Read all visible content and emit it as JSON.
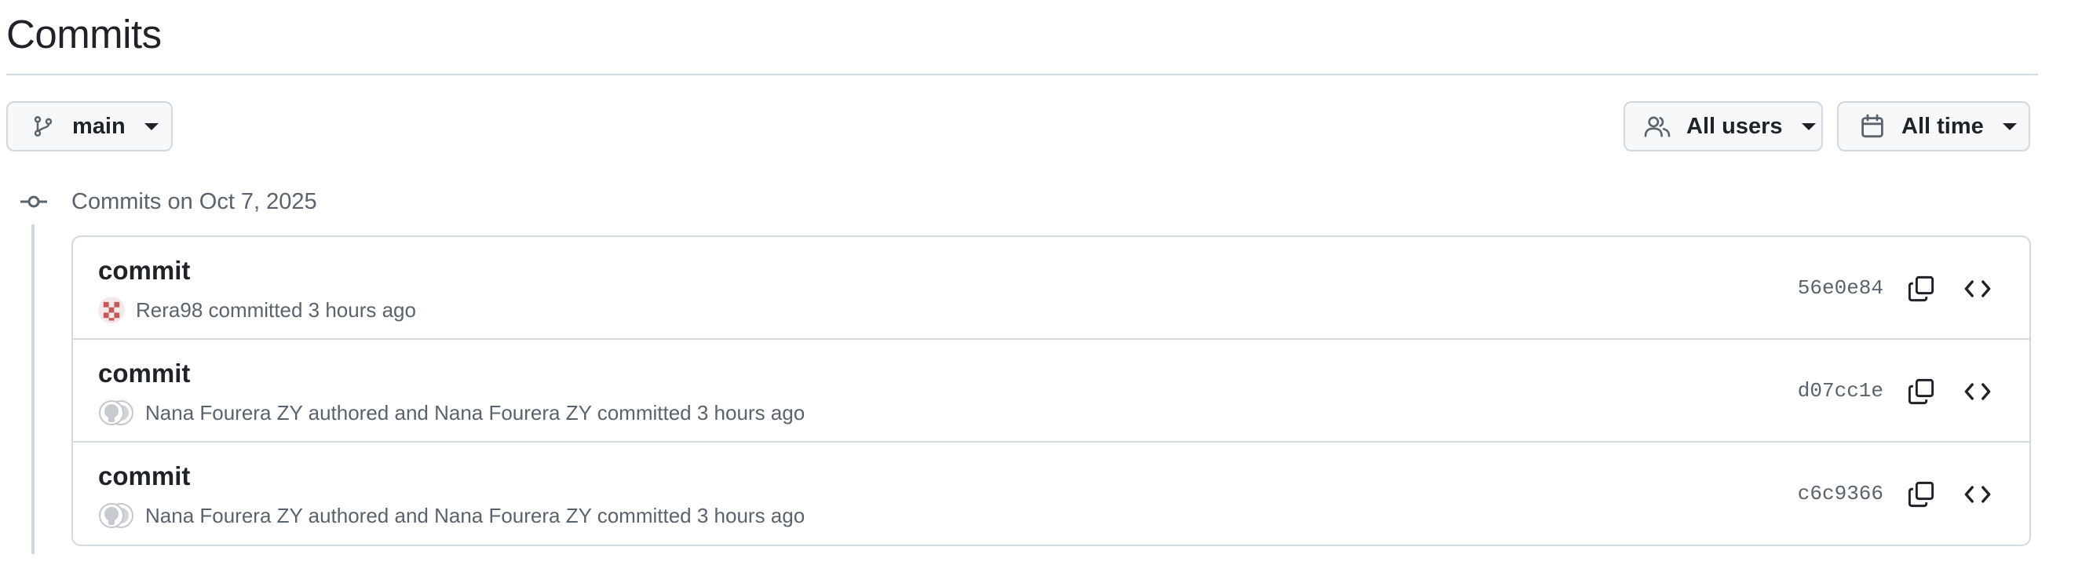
{
  "page": {
    "title": "Commits"
  },
  "filters": {
    "branch": {
      "label": "main",
      "icon": "git-branch-icon"
    },
    "users": {
      "label": "All users",
      "icon": "people-icon"
    },
    "time": {
      "label": "All time",
      "icon": "calendar-icon"
    }
  },
  "groups": [
    {
      "heading": "Commits on Oct 7, 2025",
      "commits": [
        {
          "message": "commit",
          "meta": "Rera98 committed 3 hours ago",
          "author_avatar": "pixel-avatar",
          "sha": "56e0e84"
        },
        {
          "message": "commit",
          "meta": "Nana Fourera ZY authored and Nana Fourera ZY committed 3 hours ago",
          "author_avatar": "octocat-avatar-pair",
          "sha": "d07cc1e"
        },
        {
          "message": "commit",
          "meta": "Nana Fourera ZY authored and Nana Fourera ZY committed 3 hours ago",
          "author_avatar": "octocat-avatar-pair",
          "sha": "c6c9366"
        }
      ]
    }
  ],
  "colors": {
    "text_primary": "#1f2328",
    "text_muted": "#59636e",
    "border": "#d1d9e0",
    "button_bg": "#f6f8fa"
  }
}
